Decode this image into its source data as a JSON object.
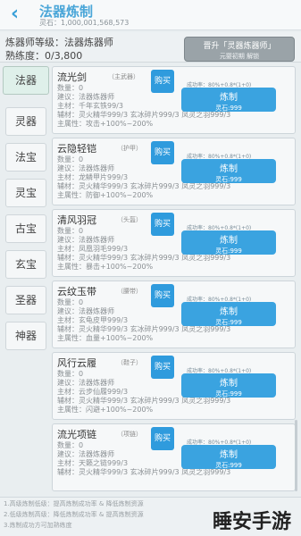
{
  "header": {
    "title": "法器炼制",
    "stone_text": "灵石：1,000,001,568,573"
  },
  "level": {
    "line1": "炼器师等级：法器炼器师",
    "line2": "熟练度：0/3,800",
    "promote_title": "晋升「灵器炼器师」",
    "promote_sub": "元婴初期 解锁"
  },
  "sidebar": {
    "items": [
      {
        "label": "法器"
      },
      {
        "label": "灵器"
      },
      {
        "label": "法宝"
      },
      {
        "label": "灵宝"
      },
      {
        "label": "古宝"
      },
      {
        "label": "玄宝"
      },
      {
        "label": "圣器"
      },
      {
        "label": "神器"
      }
    ]
  },
  "cards": [
    {
      "name": "流光剑",
      "tag": "（主武器）",
      "qty": "数量：0",
      "advice": "建议：法器炼器师",
      "main": "主材：千年玄铁99/3",
      "aux": "辅材：灵火精华999/3 玄冰碎片999/3 凤灵之羽999/3",
      "attr": "主属性：攻击+100%~200%",
      "rate": "成功率：80%+0.8*(1+0)",
      "buy": "购买",
      "craft": "炼制",
      "cost": "灵石:999"
    },
    {
      "name": "云隐轻铠",
      "tag": "（护甲）",
      "qty": "数量：0",
      "advice": "建议：法器炼器师",
      "main": "主材：龙鳞甲片999/3",
      "aux": "辅材：灵火精华999/3 玄冰碎片999/3 凤灵之羽999/3",
      "attr": "主属性：防御+100%~200%",
      "rate": "成功率：80%+0.8*(1+0)",
      "buy": "购买",
      "craft": "炼制",
      "cost": "灵石:999"
    },
    {
      "name": "清风羽冠",
      "tag": "（头盔）",
      "qty": "数量：0",
      "advice": "建议：法器炼器师",
      "main": "主材：凤凰羽毛999/3",
      "aux": "辅材：灵火精华999/3 玄冰碎片999/3 凤灵之羽999/3",
      "attr": "主属性：暴击+100%~200%",
      "rate": "成功率：80%+0.8*(1+0)",
      "buy": "购买",
      "craft": "炼制",
      "cost": "灵石:999"
    },
    {
      "name": "云纹玉带",
      "tag": "（腰带）",
      "qty": "数量：0",
      "advice": "建议：法器炼器师",
      "main": "主材：玄龟皮甲999/3",
      "aux": "辅材：灵火精华999/3 玄冰碎片999/3 凤灵之羽999/3",
      "attr": "主属性：血量+100%~200%",
      "rate": "成功率：80%+0.8*(1+0)",
      "buy": "购买",
      "craft": "炼制",
      "cost": "灵石:999"
    },
    {
      "name": "风行云履",
      "tag": "（鞋子）",
      "qty": "数量：0",
      "advice": "建议：法器炼器师",
      "main": "主材：云步仙履999/3",
      "aux": "辅材：灵火精华999/3 玄冰碎片999/3 凤灵之羽999/3",
      "attr": "主属性：闪避+100%~200%",
      "rate": "成功率：80%+0.8*(1+0)",
      "buy": "购买",
      "craft": "炼制",
      "cost": "灵石:999"
    },
    {
      "name": "流光项链",
      "tag": "（项链）",
      "qty": "数量：0",
      "advice": "建议：法器炼器师",
      "main": "主材：天籁之链999/3",
      "aux": "辅材：灵火精华999/3 玄冰碎片999/3 凤灵之羽999/3",
      "attr": "",
      "rate": "成功率：80%+0.8*(1+0)",
      "buy": "购买",
      "craft": "炼制",
      "cost": "灵石:999"
    }
  ],
  "notes": [
    "1.高级炼制低级：提高炼制成功率 & 降低炼制资源",
    "2.低级炼制高级：降低炼制成功率 & 提高炼制资源",
    "3.炼制成功方可加熟练度"
  ],
  "watermark": "睡安手游网"
}
